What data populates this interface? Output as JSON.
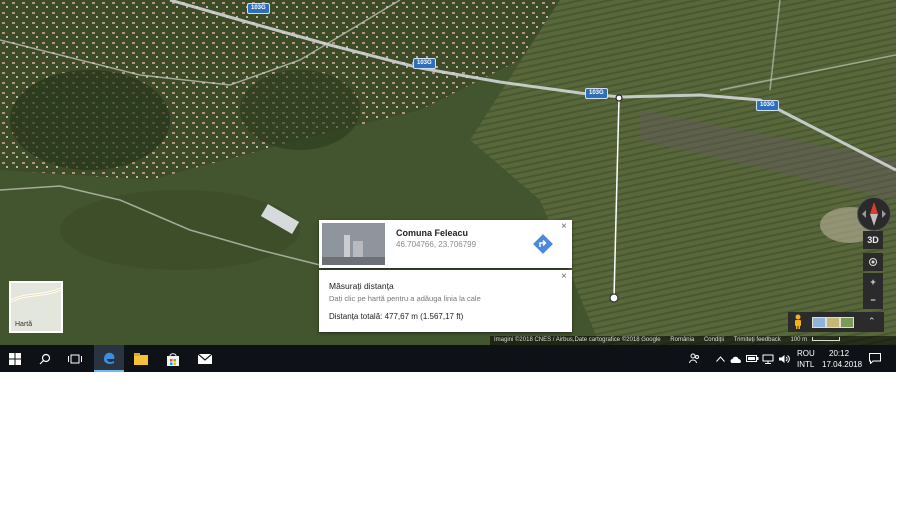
{
  "map": {
    "road_labels": [
      "103G",
      "103G",
      "103G",
      "103G"
    ],
    "road_color": "#d9dde0",
    "measure_line_color": "#ffffff"
  },
  "place_card": {
    "name": "Comuna Feleacu",
    "coords": "46.704766, 23.706799",
    "close_icon": "×",
    "directions_icon": "directions-arrow-icon",
    "accent": "#4a89dc"
  },
  "measure_card": {
    "title": "Măsurați distanța",
    "hint": "Dați clic pe hartă pentru a adăuga linia la cale",
    "total": "Distanța totală: 477,67 m (1.567,17 ft)",
    "close_icon": "×"
  },
  "controls": {
    "compass_icon": "compass-icon",
    "view_3d": "3D",
    "locate_icon": "my-location-icon",
    "zoom_in": "+",
    "zoom_out": "−",
    "pegman_icon": "pegman-icon",
    "expand_icon": "⌃"
  },
  "minimap": {
    "label": "Hartă"
  },
  "attribution": {
    "imagery": "Imagini ©2018 CNES / Airbus,Date cartografice ©2018 Google",
    "region": "România",
    "terms": "Condiții",
    "feedback": "Trimiteți feedback",
    "scale": "100 m"
  },
  "taskbar": {
    "icons": [
      "windows-start-icon",
      "search-icon",
      "task-view-icon",
      "edge-icon",
      "file-explorer-icon",
      "store-icon",
      "mail-icon"
    ],
    "tray_icons": [
      "people-icon",
      "chevron-up-icon",
      "cloud-icon",
      "battery-icon",
      "network-icon",
      "volume-icon"
    ],
    "lang_top": "ROU",
    "lang_bottom": "INTL",
    "time": "20:12",
    "date": "17.04.2018",
    "notification_icon": "action-center-icon"
  }
}
